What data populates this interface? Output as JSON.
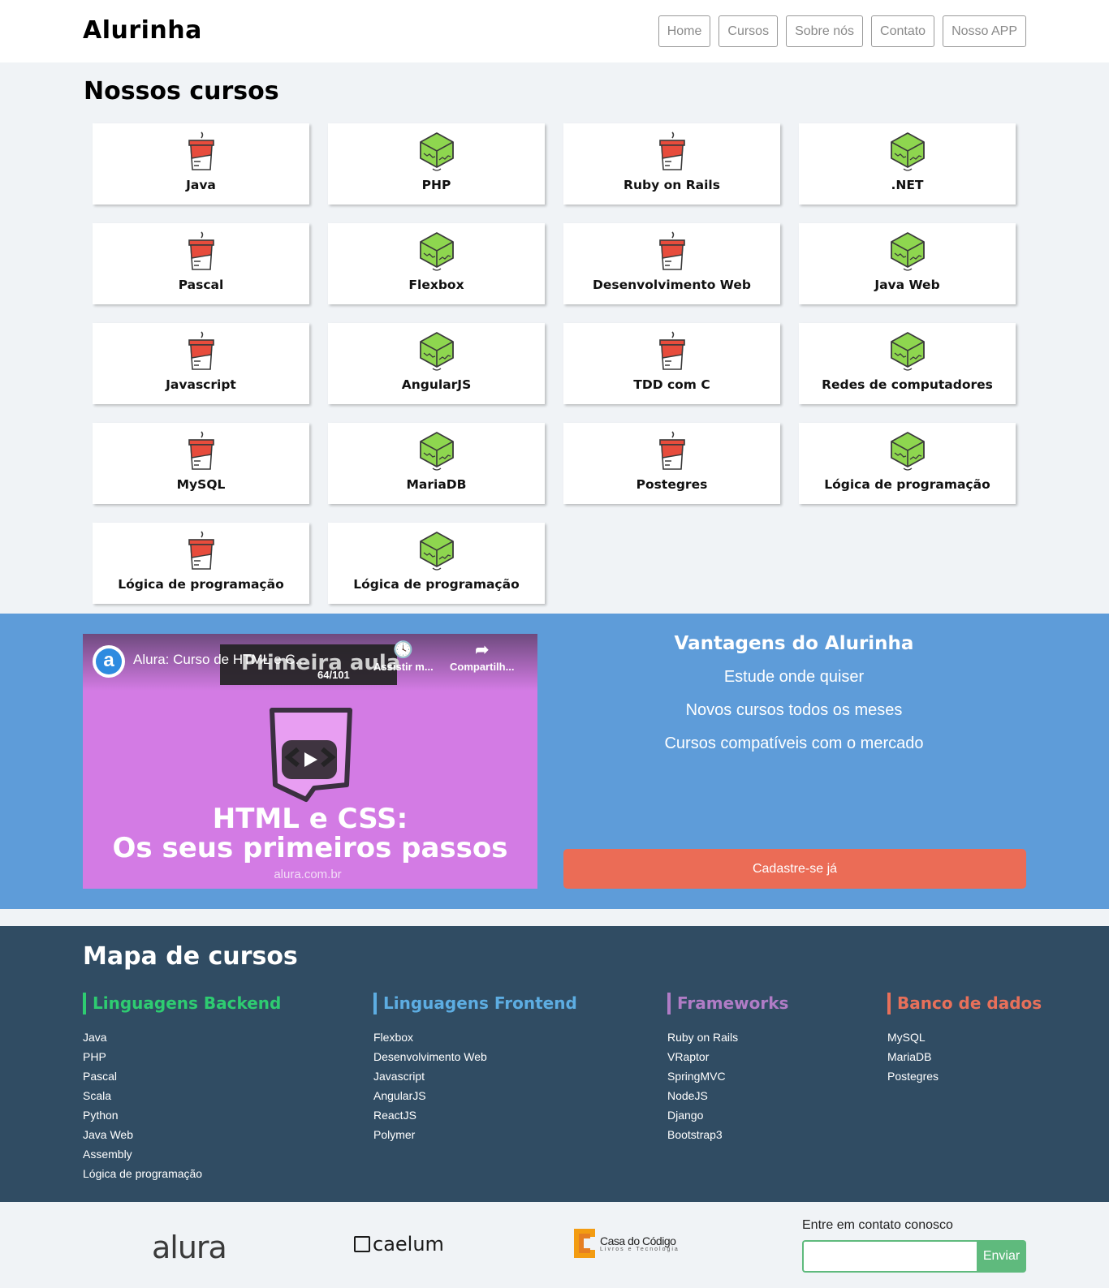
{
  "header": {
    "logo": "Alurinha",
    "nav": [
      "Home",
      "Cursos",
      "Sobre nós",
      "Contato",
      "Nosso APP"
    ]
  },
  "courses": {
    "title": "Nossos cursos",
    "items": [
      {
        "name": "Java",
        "icon": "coffee-cup-icon"
      },
      {
        "name": "PHP",
        "icon": "green-cube-icon"
      },
      {
        "name": "Ruby on Rails",
        "icon": "coffee-cup-icon"
      },
      {
        "name": ".NET",
        "icon": "green-cube-icon"
      },
      {
        "name": "Pascal",
        "icon": "coffee-cup-icon"
      },
      {
        "name": "Flexbox",
        "icon": "green-cube-icon"
      },
      {
        "name": "Desenvolvimento Web",
        "icon": "coffee-cup-icon"
      },
      {
        "name": "Java Web",
        "icon": "green-cube-icon"
      },
      {
        "name": "Javascript",
        "icon": "coffee-cup-icon"
      },
      {
        "name": "AngularJS",
        "icon": "green-cube-icon"
      },
      {
        "name": "TDD com C",
        "icon": "coffee-cup-icon"
      },
      {
        "name": "Redes de computadores",
        "icon": "green-cube-icon"
      },
      {
        "name": "MySQL",
        "icon": "coffee-cup-icon"
      },
      {
        "name": "MariaDB",
        "icon": "green-cube-icon"
      },
      {
        "name": "Postegres",
        "icon": "coffee-cup-icon"
      },
      {
        "name": "Lógica de programação",
        "icon": "green-cube-icon"
      },
      {
        "name": "Lógica de programação",
        "icon": "coffee-cup-icon"
      },
      {
        "name": "Lógica de programação",
        "icon": "green-cube-icon"
      }
    ]
  },
  "video": {
    "channel_icon": "alura-a-icon",
    "channel_letter": "a",
    "title": "Alura: Curso de HTML e C...",
    "overlay_title": "Primeira aula",
    "counter": "64/101",
    "watch_later": "Assistir m...",
    "share": "Compartilh...",
    "heading_line1": "HTML e CSS:",
    "heading_line2": "Os seus primeiros passos",
    "url": "alura.com.br"
  },
  "advantages": {
    "title": "Vantagens do Alurinha",
    "items": [
      "Estude onde quiser",
      "Novos cursos todos os meses",
      "Cursos compatíveis com o mercado"
    ],
    "cta": "Cadastre-se já"
  },
  "course_map": {
    "title": "Mapa de cursos",
    "columns": [
      {
        "title": "Linguagens Backend",
        "color": "#2ecc71",
        "items": [
          "Java",
          "PHP",
          "Pascal",
          "Scala",
          "Python",
          "Java Web",
          "Assembly",
          "Lógica de programação"
        ]
      },
      {
        "title": "Linguagens Frontend",
        "color": "#5dade2",
        "items": [
          "Flexbox",
          "Desenvolvimento Web",
          "Javascript",
          "AngularJS",
          "ReactJS",
          "Polymer"
        ]
      },
      {
        "title": "Frameworks",
        "color": "#b07cc6",
        "items": [
          "Ruby on Rails",
          "VRaptor",
          "SpringMVC",
          "NodeJS",
          "Django",
          "Bootstrap3"
        ]
      },
      {
        "title": "Banco de dados",
        "color": "#e8705a",
        "items": [
          "MySQL",
          "MariaDB",
          "Postegres"
        ]
      }
    ]
  },
  "footer": {
    "brands": {
      "alura": "alura",
      "caelum": "caelum",
      "cdc_name": "Casa do Código",
      "cdc_sub": "Livros e Tecnologia"
    },
    "contact_label": "Entre em contato conosco",
    "contact_button": "Enviar"
  },
  "colors": {
    "header_bg": "#ffffff",
    "page_bg": "#f0f3f6",
    "promo_bg": "#5e9cd9",
    "cta": "#eb6c56",
    "map_bg": "#304c63",
    "send_button": "#5fba7d"
  }
}
